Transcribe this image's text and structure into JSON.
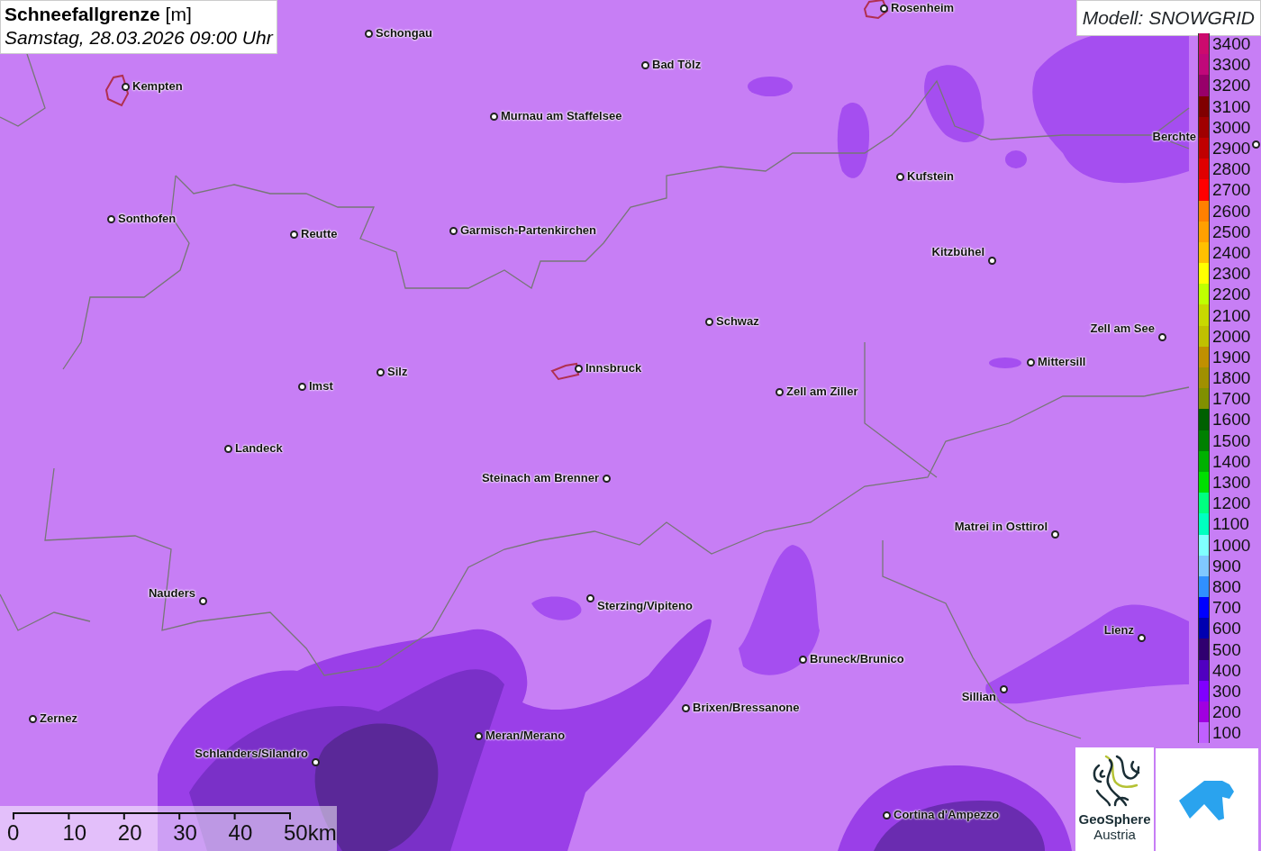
{
  "header": {
    "title": "**Schneefallgrenze** [m]",
    "subtitle": "Samstag, 28.03.2026 09:00 Uhr"
  },
  "model": "Modell: SNOWGRID",
  "cities": [
    {
      "name": "Rosenheim"
    },
    {
      "name": "Schongau"
    },
    {
      "name": "Bad Tölz"
    },
    {
      "name": "Kempten"
    },
    {
      "name": "Murnau am Staffelsee"
    },
    {
      "name": "Berchte"
    },
    {
      "name": "Kufstein"
    },
    {
      "name": "Sonthofen"
    },
    {
      "name": "Reutte"
    },
    {
      "name": "Garmisch-Partenkirchen"
    },
    {
      "name": "Kitzbühel"
    },
    {
      "name": "Schwaz"
    },
    {
      "name": "Zell am See"
    },
    {
      "name": "Mittersill"
    },
    {
      "name": "Innsbruck"
    },
    {
      "name": "Silz"
    },
    {
      "name": "Imst"
    },
    {
      "name": "Zell am Ziller"
    },
    {
      "name": "Landeck"
    },
    {
      "name": "Steinach am Brenner"
    },
    {
      "name": "Matrei in Osttirol"
    },
    {
      "name": "Nauders"
    },
    {
      "name": "Sterzing/Vipiteno"
    },
    {
      "name": "Lienz"
    },
    {
      "name": "Bruneck/Brunico"
    },
    {
      "name": "Sillian"
    },
    {
      "name": "Brixen/Bressanone"
    },
    {
      "name": "Zernez"
    },
    {
      "name": "Meran/Merano"
    },
    {
      "name": "Schlanders/Silandro"
    },
    {
      "name": "Cortina d'Ampezzo"
    }
  ],
  "legend": [
    {
      "label": "3400",
      "color": "#cc0a6e"
    },
    {
      "label": "3300",
      "color": "#c0087a"
    },
    {
      "label": "3200",
      "color": "#98006a"
    },
    {
      "label": "3100",
      "color": "#800000"
    },
    {
      "label": "3000",
      "color": "#a00000"
    },
    {
      "label": "2900",
      "color": "#c00000"
    },
    {
      "label": "2800",
      "color": "#e00000"
    },
    {
      "label": "2700",
      "color": "#ff0000"
    },
    {
      "label": "2600",
      "color": "#ff8000"
    },
    {
      "label": "2500",
      "color": "#ffa000"
    },
    {
      "label": "2400",
      "color": "#ffc000"
    },
    {
      "label": "2300",
      "color": "#ffff00"
    },
    {
      "label": "2200",
      "color": "#c0ff00"
    },
    {
      "label": "2100",
      "color": "#c8d800"
    },
    {
      "label": "2000",
      "color": "#c0c000"
    },
    {
      "label": "1900",
      "color": "#c09000"
    },
    {
      "label": "1800",
      "color": "#a09000"
    },
    {
      "label": "1700",
      "color": "#809000"
    },
    {
      "label": "1600",
      "color": "#006000"
    },
    {
      "label": "1500",
      "color": "#008000"
    },
    {
      "label": "1400",
      "color": "#00b000"
    },
    {
      "label": "1300",
      "color": "#00e000"
    },
    {
      "label": "1200",
      "color": "#00ff80"
    },
    {
      "label": "1100",
      "color": "#00ffc0"
    },
    {
      "label": "1000",
      "color": "#80ffff"
    },
    {
      "label": "900",
      "color": "#80c8ff"
    },
    {
      "label": "800",
      "color": "#3090ff"
    },
    {
      "label": "700",
      "color": "#0000ff"
    },
    {
      "label": "600",
      "color": "#0000b0"
    },
    {
      "label": "500",
      "color": "#300070"
    },
    {
      "label": "400",
      "color": "#5000c0"
    },
    {
      "label": "300",
      "color": "#8000ff"
    },
    {
      "label": "200",
      "color": "#a000e0"
    },
    {
      "label": "100",
      "color": "#c060ff"
    }
  ],
  "scale": [
    "0",
    "10",
    "20",
    "30",
    "40",
    "50km"
  ],
  "logo": {
    "line1": "GeoSphere",
    "line2": "Austria"
  }
}
